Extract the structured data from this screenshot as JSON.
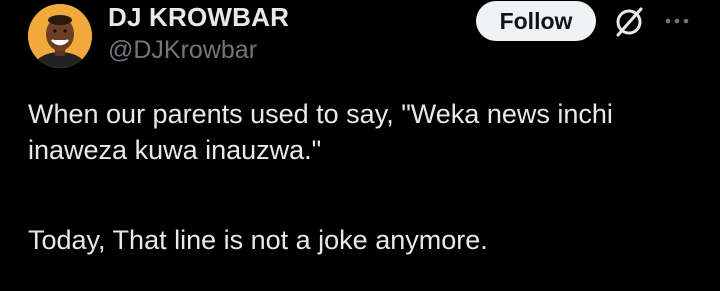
{
  "author": {
    "display_name": "DJ KROWBAR",
    "handle": "@DJKrowbar",
    "avatar_icon": "profile-photo"
  },
  "header": {
    "follow_label": "Follow",
    "grok_icon": "grok-slash-circle-icon",
    "more_icon": "more-dots-icon"
  },
  "tweet": {
    "line1": "When our parents used to say, \"Weka news inchi",
    "line2": "inaweza kuwa inauzwa.\"",
    "line3": "Today, That line is not a joke anymore."
  },
  "colors": {
    "background": "#000000",
    "text": "#e7e9ea",
    "secondary_text": "#71767b",
    "follow_bg": "#eff3f4",
    "avatar_bg": "#f2a93b"
  }
}
